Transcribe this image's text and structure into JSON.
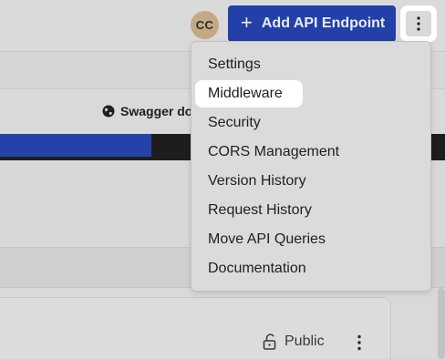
{
  "header": {
    "avatar_initials": "CC",
    "add_button_label": "Add API Endpoint",
    "add_button_icon": "plus-icon",
    "more_button_icon": "vertical-dots-icon"
  },
  "toolbar": {
    "swagger_label": "Swagger do",
    "swagger_icon": "globe-icon"
  },
  "progress": {
    "fill_fraction": 0.34,
    "fill_color": "#2343a8",
    "track_color": "#1d1d1d"
  },
  "menu": {
    "items": [
      {
        "label": "Settings"
      },
      {
        "label": "Middleware",
        "highlighted": true
      },
      {
        "label": "Security"
      },
      {
        "label": "CORS Management"
      },
      {
        "label": "Version History"
      },
      {
        "label": "Request History"
      },
      {
        "label": "Move API Queries"
      },
      {
        "label": "Documentation"
      }
    ]
  },
  "card": {
    "visibility_label": "Public",
    "visibility_icon": "unlock-icon",
    "more_icon": "vertical-dots-icon"
  },
  "colors": {
    "accent": "#233fa8",
    "background": "#d9d9d9"
  }
}
